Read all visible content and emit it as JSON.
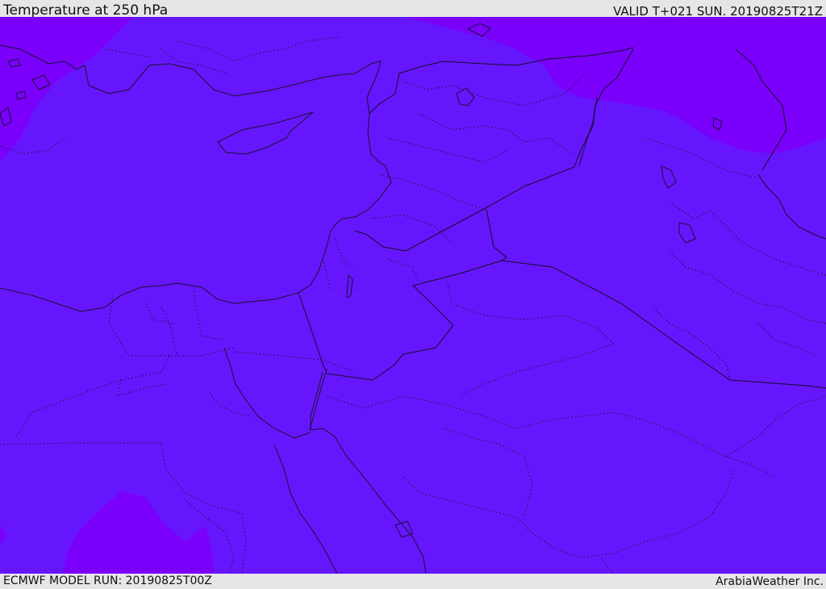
{
  "header": {
    "title": "Temperature at 250 hPa",
    "valid": "VALID T+021 SUN. 20190825T21Z"
  },
  "footer": {
    "model_run": "ECMWF MODEL RUN: 20190825T00Z",
    "credit": "ArabiaWeather Inc."
  },
  "map": {
    "colors": {
      "field_main": "#6616fc",
      "field_warm": "#7a00fb",
      "coastline": "#1a1030",
      "border": "#140c28"
    }
  }
}
